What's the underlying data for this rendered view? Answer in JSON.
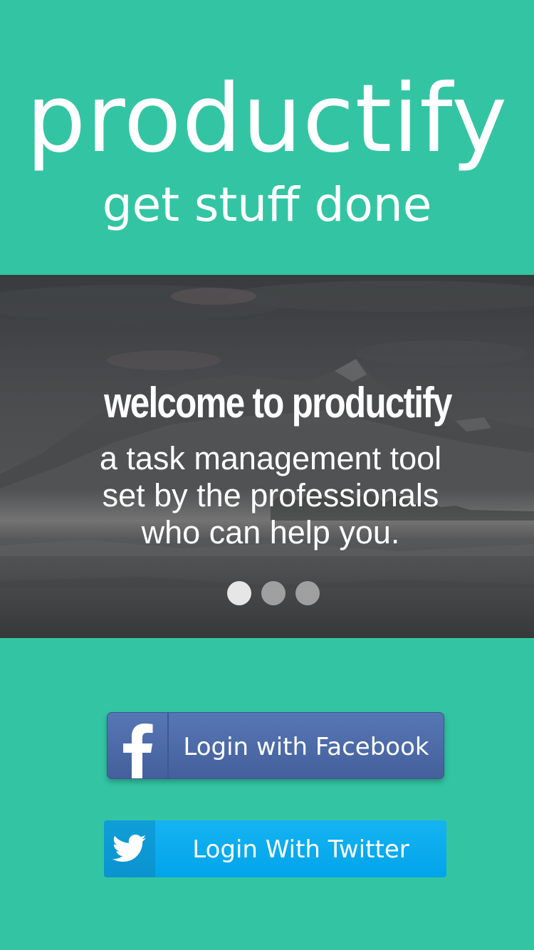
{
  "brand": {
    "title": "productify",
    "tagline": "get stuff done"
  },
  "hero": {
    "heading": "welcome to productify",
    "body_lines": [
      "a task management tool",
      "set by the professionals",
      "who can help you."
    ],
    "background_icon": "mountain-lake-photo",
    "pagination": {
      "total": 3,
      "active_index": 0
    }
  },
  "login": {
    "facebook": {
      "label": "Login with Facebook",
      "icon": "facebook-icon",
      "color": "#4c6aa6"
    },
    "twitter": {
      "label": "Login With Twitter",
      "icon": "twitter-icon",
      "color": "#02a4ea"
    }
  },
  "colors": {
    "background": "#33c5a3",
    "text": "#ffffff"
  }
}
